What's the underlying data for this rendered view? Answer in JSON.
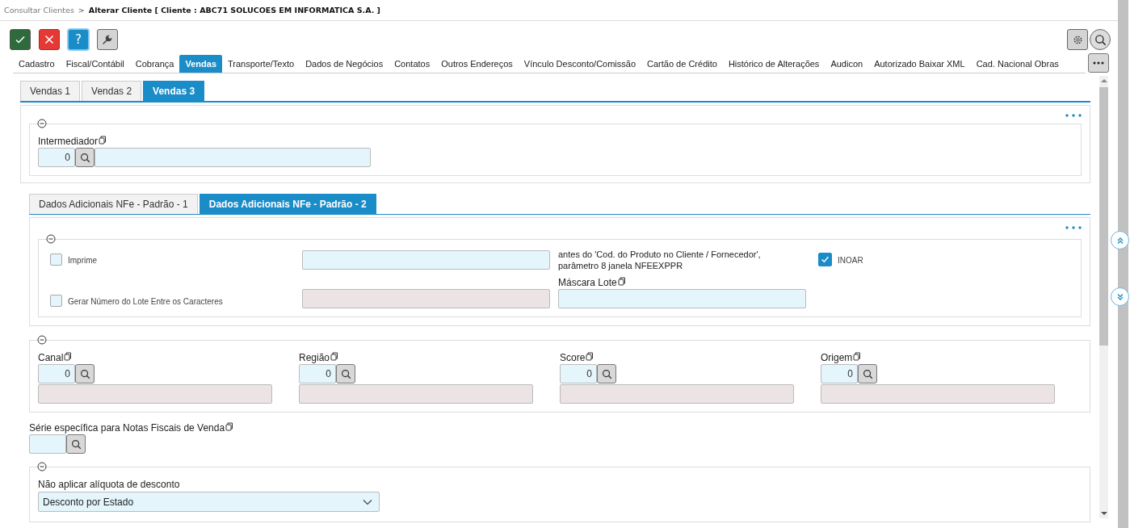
{
  "breadcrumb": {
    "parent": "Consultar Clientes",
    "separator": ">",
    "current": "Alterar Cliente [ Cliente : ABC71 SOLUCOES EM INFORMATICA S.A. ]"
  },
  "actions": [
    {
      "kind": "confirm"
    },
    {
      "kind": "cancel"
    },
    {
      "kind": "help",
      "label": "?"
    },
    {
      "kind": "tools"
    }
  ],
  "tabs": [
    {
      "label": "Cadastro",
      "selected": false
    },
    {
      "label": "Fiscal/Contábil",
      "selected": false
    },
    {
      "label": "Cobrança",
      "selected": false
    },
    {
      "label": "Vendas",
      "selected": true
    },
    {
      "label": "Transporte/Texto",
      "selected": false
    },
    {
      "label": "Dados de Negócios",
      "selected": false
    },
    {
      "label": "Contatos",
      "selected": false
    },
    {
      "label": "Outros Endereços",
      "selected": false
    },
    {
      "label": "Vínculo Desconto/Comissão",
      "selected": false
    },
    {
      "label": "Cartão de Crédito",
      "selected": false
    },
    {
      "label": "Histórico de Alterações",
      "selected": false
    },
    {
      "label": "Audicon",
      "selected": false
    },
    {
      "label": "Autorizado Baixar XML",
      "selected": false
    },
    {
      "label": "Cad. Nacional Obras",
      "selected": false
    }
  ],
  "sub_tabs": [
    {
      "label": "Vendas 1",
      "selected": false
    },
    {
      "label": "Vendas 2",
      "selected": false
    },
    {
      "label": "Vendas 3",
      "selected": true
    }
  ],
  "intermediador": {
    "label": "Intermediador",
    "code": "0",
    "disabled": false
  },
  "nfe_tabs": [
    {
      "label": "Dados Adicionais NFe - Padrão - 1",
      "selected": false
    },
    {
      "label": "Dados Adicionais NFe - Padrão - 2",
      "selected": true
    }
  ],
  "nfe_panel": {
    "imprime": {
      "label": "Imprime",
      "checked": false
    },
    "imprime_note": "antes do 'Cod. do Produto no Cliente / Fornecedor', parâmetro 8 janela NFEEXPPR",
    "inoar": {
      "label": "INOAR",
      "checked": true
    },
    "gerar_lote": {
      "label": "Gerar Número do Lote Entre os Caracteres",
      "checked": false
    },
    "mascara_lote": {
      "label": "Máscara Lote"
    }
  },
  "lookups": [
    {
      "label": "Canal",
      "code": "0",
      "disabled": true
    },
    {
      "label": "Região",
      "code": "0",
      "disabled": true
    },
    {
      "label": "Score",
      "code": "0",
      "disabled": true
    },
    {
      "label": "Origem",
      "code": "0",
      "disabled": true
    }
  ],
  "serie": {
    "label": "Série específica para Notas Fiscais de Venda"
  },
  "desconto": {
    "label": "Não aplicar alíquota de desconto",
    "value": "Desconto por Estado"
  }
}
